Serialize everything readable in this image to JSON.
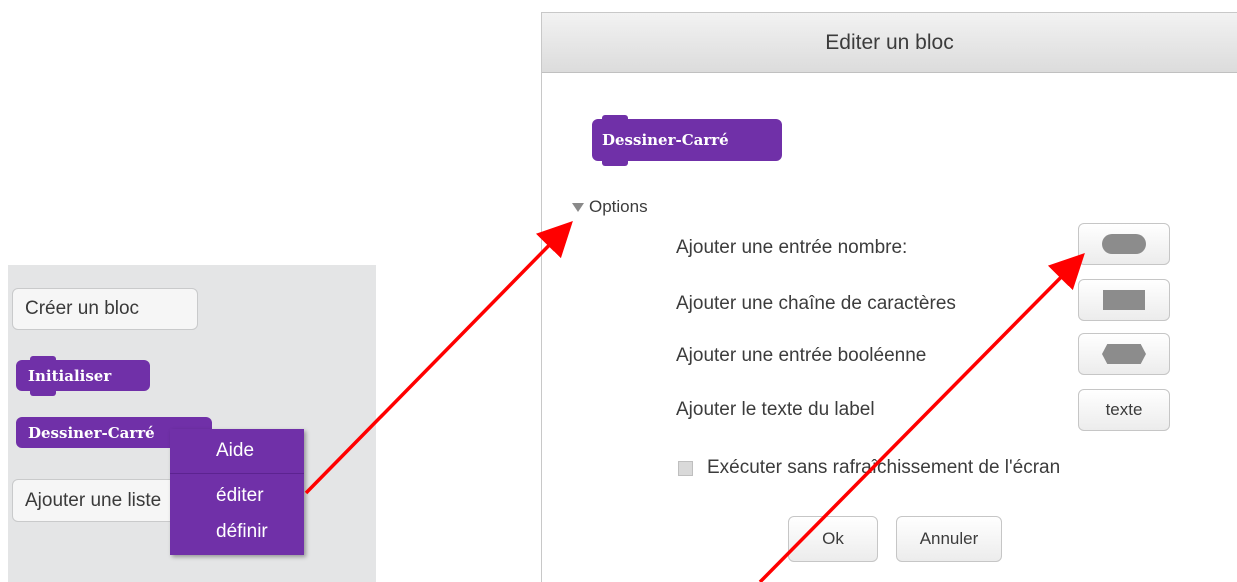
{
  "palette": {
    "create_block": "Créer un bloc",
    "blocks": [
      "Initialiser",
      "Dessiner-Carré"
    ],
    "add_list": "Ajouter une liste",
    "context_menu": {
      "items": [
        "Aide",
        "éditer",
        "définir"
      ]
    }
  },
  "dialog": {
    "title": "Editer un bloc",
    "block_name": "Dessiner-Carré",
    "options_label": "Options",
    "options": [
      {
        "label": "Ajouter une entrée nombre:",
        "button": "round-input-shape"
      },
      {
        "label": "Ajouter une chaîne de caractères",
        "button": "rect-input-shape"
      },
      {
        "label": "Ajouter une entrée booléenne",
        "button": "hex-input-shape"
      },
      {
        "label": "Ajouter le texte du label",
        "button_text": "texte"
      }
    ],
    "checkbox_label": "Exécuter sans rafraîchissement de l'écran",
    "checkbox_checked": false,
    "ok": "Ok",
    "cancel": "Annuler"
  },
  "colors": {
    "block_purple": "#7030a8",
    "arrow_red": "#ff0000",
    "palette_bg": "#e4e5e6"
  }
}
